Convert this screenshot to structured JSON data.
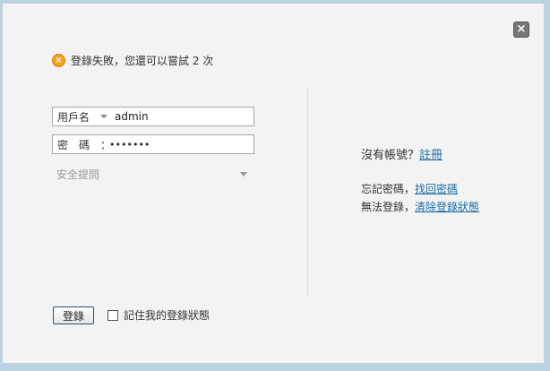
{
  "dialog": {
    "close_label": "×"
  },
  "error": {
    "icon_glyph": "×",
    "message": "登錄失敗，您還可以嘗試 2 次"
  },
  "form": {
    "username_label": "用戶名",
    "username_value": "admin",
    "password_label": "密　碼　：",
    "password_value": "•••••••",
    "security_question_placeholder": "安全提問"
  },
  "side_links": {
    "no_account_text": "沒有帳號？",
    "register_link": "註冊",
    "forgot_text": "忘記密碼，",
    "recover_link": "找回密碼",
    "cannot_login_text": "無法登錄，",
    "clear_status_link": "清除登錄狀態"
  },
  "actions": {
    "login_label": "登錄",
    "remember_label": "記住我的登錄狀態"
  },
  "colors": {
    "link": "#1a6ea8",
    "error_icon": "#f7a21b",
    "dialog_bg": "#f3f3f3",
    "page_bg": "#b9d3e3"
  }
}
